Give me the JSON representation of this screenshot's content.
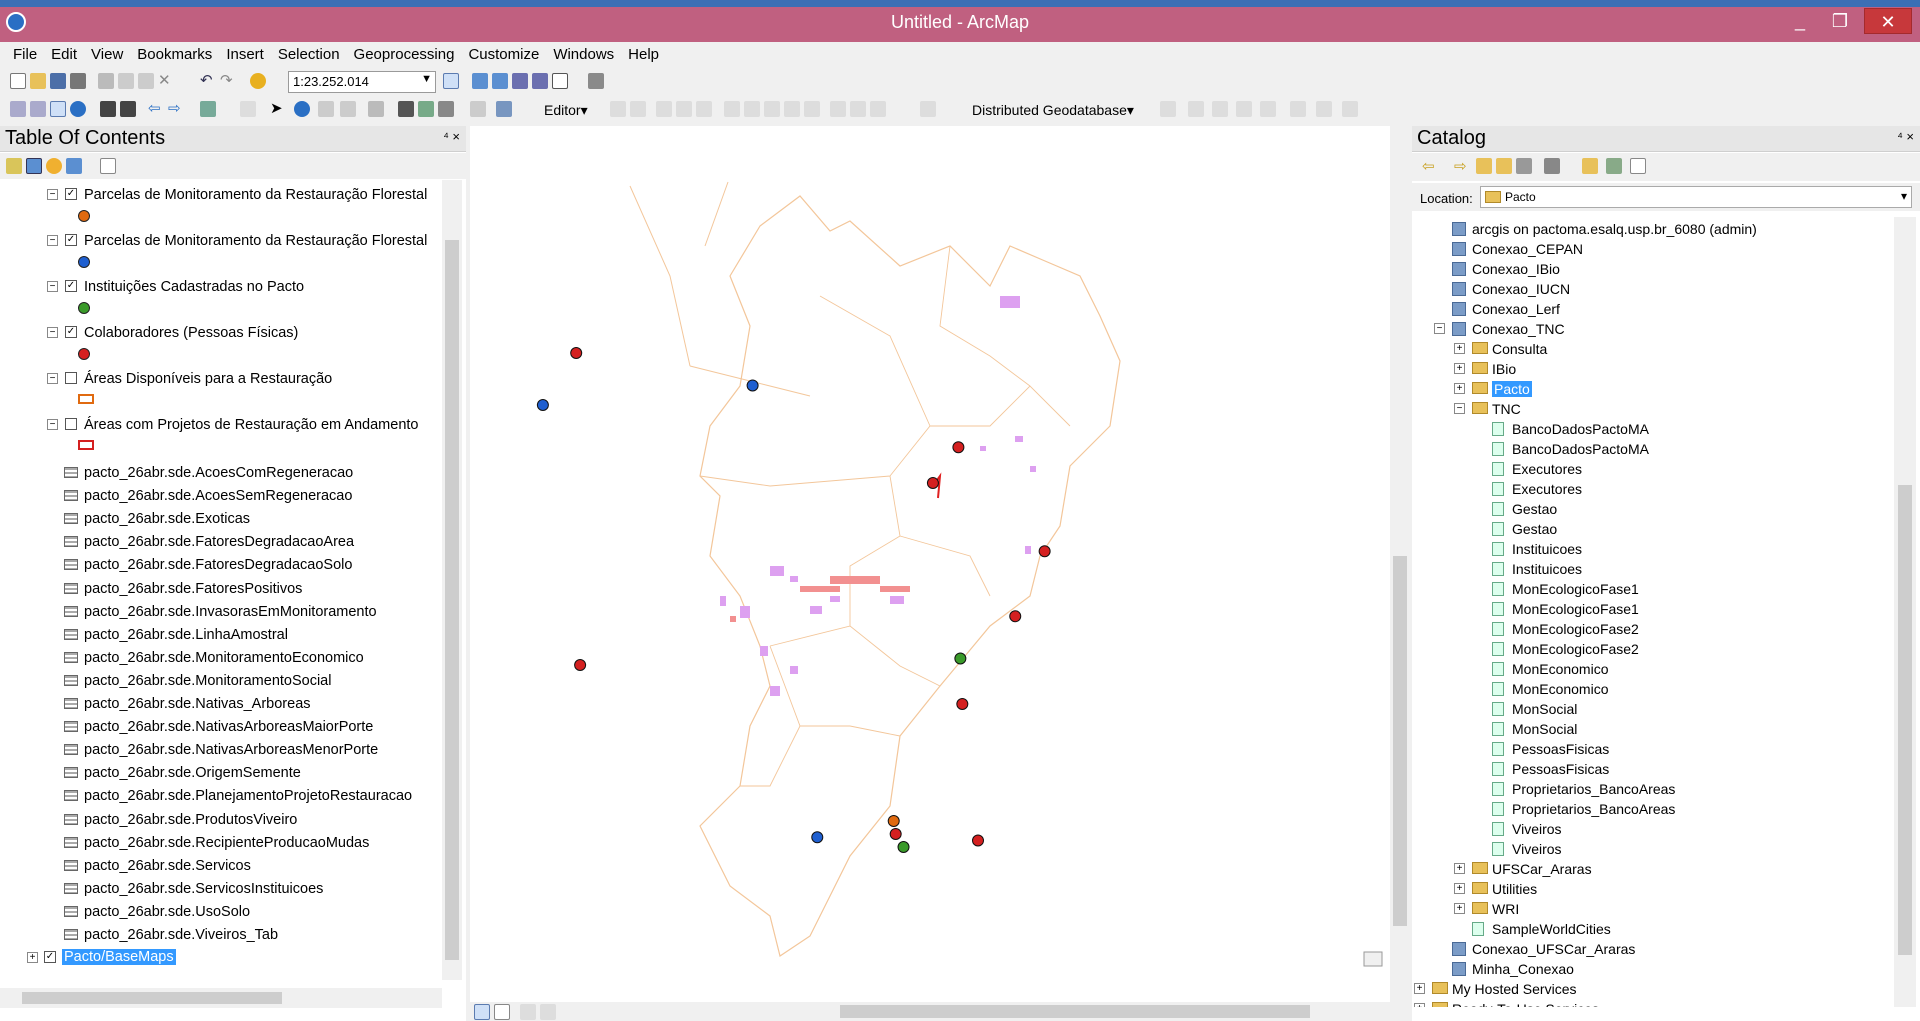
{
  "window": {
    "title": "Untitled - ArcMap",
    "minimize": "_",
    "maximize": "❐",
    "close": "✕"
  },
  "menu": [
    "File",
    "Edit",
    "View",
    "Bookmarks",
    "Insert",
    "Selection",
    "Geoprocessing",
    "Customize",
    "Windows",
    "Help"
  ],
  "toolbar": {
    "scale": "1:23.252.014",
    "editor_label": "Editor▾",
    "geodatabase_label": "Distributed Geodatabase▾"
  },
  "toc": {
    "title": "Table Of Contents",
    "pin": "⁴ ×",
    "layers": [
      {
        "label": "Parcelas de Monitoramento da Restauração Florestal",
        "checked": true,
        "symbol": "point-orange"
      },
      {
        "label": "Parcelas de Monitoramento da Restauração Florestal",
        "checked": true,
        "symbol": "point-blue"
      },
      {
        "label": "Instituições Cadastradas no Pacto",
        "checked": true,
        "symbol": "point-green"
      },
      {
        "label": "Colaboradores (Pessoas Físicas)",
        "checked": true,
        "symbol": "point-red"
      },
      {
        "label": "Áreas Disponíveis para a Restauração",
        "checked": false,
        "symbol": "poly-orange"
      },
      {
        "label": "Áreas com Projetos de Restauração em Andamento",
        "checked": false,
        "symbol": "poly-red"
      }
    ],
    "tables": [
      "pacto_26abr.sde.AcoesComRegeneracao",
      "pacto_26abr.sde.AcoesSemRegeneracao",
      "pacto_26abr.sde.Exoticas",
      "pacto_26abr.sde.FatoresDegradacaoArea",
      "pacto_26abr.sde.FatoresDegradacaoSolo",
      "pacto_26abr.sde.FatoresPositivos",
      "pacto_26abr.sde.InvasorasEmMonitoramento",
      "pacto_26abr.sde.LinhaAmostral",
      "pacto_26abr.sde.MonitoramentoEconomico",
      "pacto_26abr.sde.MonitoramentoSocial",
      "pacto_26abr.sde.Nativas_Arboreas",
      "pacto_26abr.sde.NativasArboreasMaiorPorte",
      "pacto_26abr.sde.NativasArboreasMenorPorte",
      "pacto_26abr.sde.OrigemSemente",
      "pacto_26abr.sde.PlanejamentoProjetoRestauracao",
      "pacto_26abr.sde.ProdutosViveiro",
      "pacto_26abr.sde.RecipienteProducaoMudas",
      "pacto_26abr.sde.Servicos",
      "pacto_26abr.sde.ServicosInstituicoes",
      "pacto_26abr.sde.UsoSolo",
      "pacto_26abr.sde.Viveiros_Tab"
    ],
    "basemap": "Pacto/BaseMaps"
  },
  "catalog": {
    "title": "Catalog",
    "pin": "⁴ ×",
    "location_label": "Location:",
    "location_value": "Pacto",
    "tree": [
      {
        "label": "arcgis on pactoma.esalq.usp.br_6080 (admin)",
        "type": "conn",
        "indent": 0
      },
      {
        "label": "Conexao_CEPAN",
        "type": "conn",
        "indent": 0
      },
      {
        "label": "Conexao_IBio",
        "type": "conn",
        "indent": 0
      },
      {
        "label": "Conexao_IUCN",
        "type": "conn",
        "indent": 0
      },
      {
        "label": "Conexao_Lerf",
        "type": "conn",
        "indent": 0
      },
      {
        "label": "Conexao_TNC",
        "type": "conn",
        "indent": 0,
        "expander": "⊟"
      },
      {
        "label": "Consulta",
        "type": "folder",
        "indent": 1,
        "expander": "⊞"
      },
      {
        "label": "IBio",
        "type": "folder",
        "indent": 1,
        "expander": "⊞"
      },
      {
        "label": "Pacto",
        "type": "folder",
        "indent": 1,
        "expander": "⊞",
        "selected": true
      },
      {
        "label": "TNC",
        "type": "folder",
        "indent": 1,
        "expander": "⊟"
      },
      {
        "label": "BancoDadosPactoMA",
        "type": "fc",
        "indent": 2
      },
      {
        "label": "BancoDadosPactoMA",
        "type": "fc",
        "indent": 2
      },
      {
        "label": "Executores",
        "type": "fc",
        "indent": 2
      },
      {
        "label": "Executores",
        "type": "fc",
        "indent": 2
      },
      {
        "label": "Gestao",
        "type": "fc",
        "indent": 2
      },
      {
        "label": "Gestao",
        "type": "fc",
        "indent": 2
      },
      {
        "label": "Instituicoes",
        "type": "fc",
        "indent": 2
      },
      {
        "label": "Instituicoes",
        "type": "fc",
        "indent": 2
      },
      {
        "label": "MonEcologicoFase1",
        "type": "fc",
        "indent": 2
      },
      {
        "label": "MonEcologicoFase1",
        "type": "fc",
        "indent": 2
      },
      {
        "label": "MonEcologicoFase2",
        "type": "fc",
        "indent": 2
      },
      {
        "label": "MonEcologicoFase2",
        "type": "fc",
        "indent": 2
      },
      {
        "label": "MonEconomico",
        "type": "fc",
        "indent": 2
      },
      {
        "label": "MonEconomico",
        "type": "fc",
        "indent": 2
      },
      {
        "label": "MonSocial",
        "type": "fc",
        "indent": 2
      },
      {
        "label": "MonSocial",
        "type": "fc",
        "indent": 2
      },
      {
        "label": "PessoasFisicas",
        "type": "fc",
        "indent": 2
      },
      {
        "label": "PessoasFisicas",
        "type": "fc",
        "indent": 2
      },
      {
        "label": "Proprietarios_BancoAreas",
        "type": "fc",
        "indent": 2
      },
      {
        "label": "Proprietarios_BancoAreas",
        "type": "fc",
        "indent": 2
      },
      {
        "label": "Viveiros",
        "type": "fc",
        "indent": 2
      },
      {
        "label": "Viveiros",
        "type": "fc",
        "indent": 2
      },
      {
        "label": "UFSCar_Araras",
        "type": "folder",
        "indent": 1,
        "expander": "⊞"
      },
      {
        "label": "Utilities",
        "type": "folder",
        "indent": 1,
        "expander": "⊞"
      },
      {
        "label": "WRI",
        "type": "folder",
        "indent": 1,
        "expander": "⊞"
      },
      {
        "label": "SampleWorldCities",
        "type": "fc",
        "indent": 1
      },
      {
        "label": "Conexao_UFSCar_Araras",
        "type": "conn",
        "indent": 0
      },
      {
        "label": "Minha_Conexao",
        "type": "conn",
        "indent": 0
      },
      {
        "label": "My Hosted Services",
        "type": "folder",
        "indent": -1,
        "expander": "⊞"
      },
      {
        "label": "Ready-To-Use Services",
        "type": "folder",
        "indent": -1,
        "expander": "⊞"
      }
    ]
  },
  "map_points": [
    {
      "color": "red",
      "lon": -75.5,
      "lat": -3.6
    },
    {
      "color": "blue",
      "lon": -77.2,
      "lat": -5.2
    },
    {
      "color": "blue",
      "lon": -66.5,
      "lat": -4.6
    },
    {
      "color": "red",
      "lon": -75.3,
      "lat": -13.2
    },
    {
      "color": "red",
      "lon": -56.0,
      "lat": -6.5
    },
    {
      "color": "red",
      "lon": -57.3,
      "lat": -7.6
    },
    {
      "color": "red",
      "lon": -51.6,
      "lat": -9.7
    },
    {
      "color": "red",
      "lon": -53.1,
      "lat": -11.7
    },
    {
      "color": "green",
      "lon": -55.9,
      "lat": -13.0
    },
    {
      "color": "red",
      "lon": -55.8,
      "lat": -14.4
    },
    {
      "color": "blue",
      "lon": -63.2,
      "lat": -18.5
    },
    {
      "color": "orange",
      "lon": -59.3,
      "lat": -18.0
    },
    {
      "color": "red",
      "lon": -59.2,
      "lat": -18.4
    },
    {
      "color": "green",
      "lon": -58.8,
      "lat": -18.8
    },
    {
      "color": "red",
      "lon": -55.0,
      "lat": -18.6
    }
  ],
  "colors": {
    "red": "#d42020",
    "blue": "#1f5fd0",
    "green": "#3a9a2a",
    "orange": "#e06a10",
    "boundary": "#f3c69a",
    "area": "#dda0f0"
  }
}
